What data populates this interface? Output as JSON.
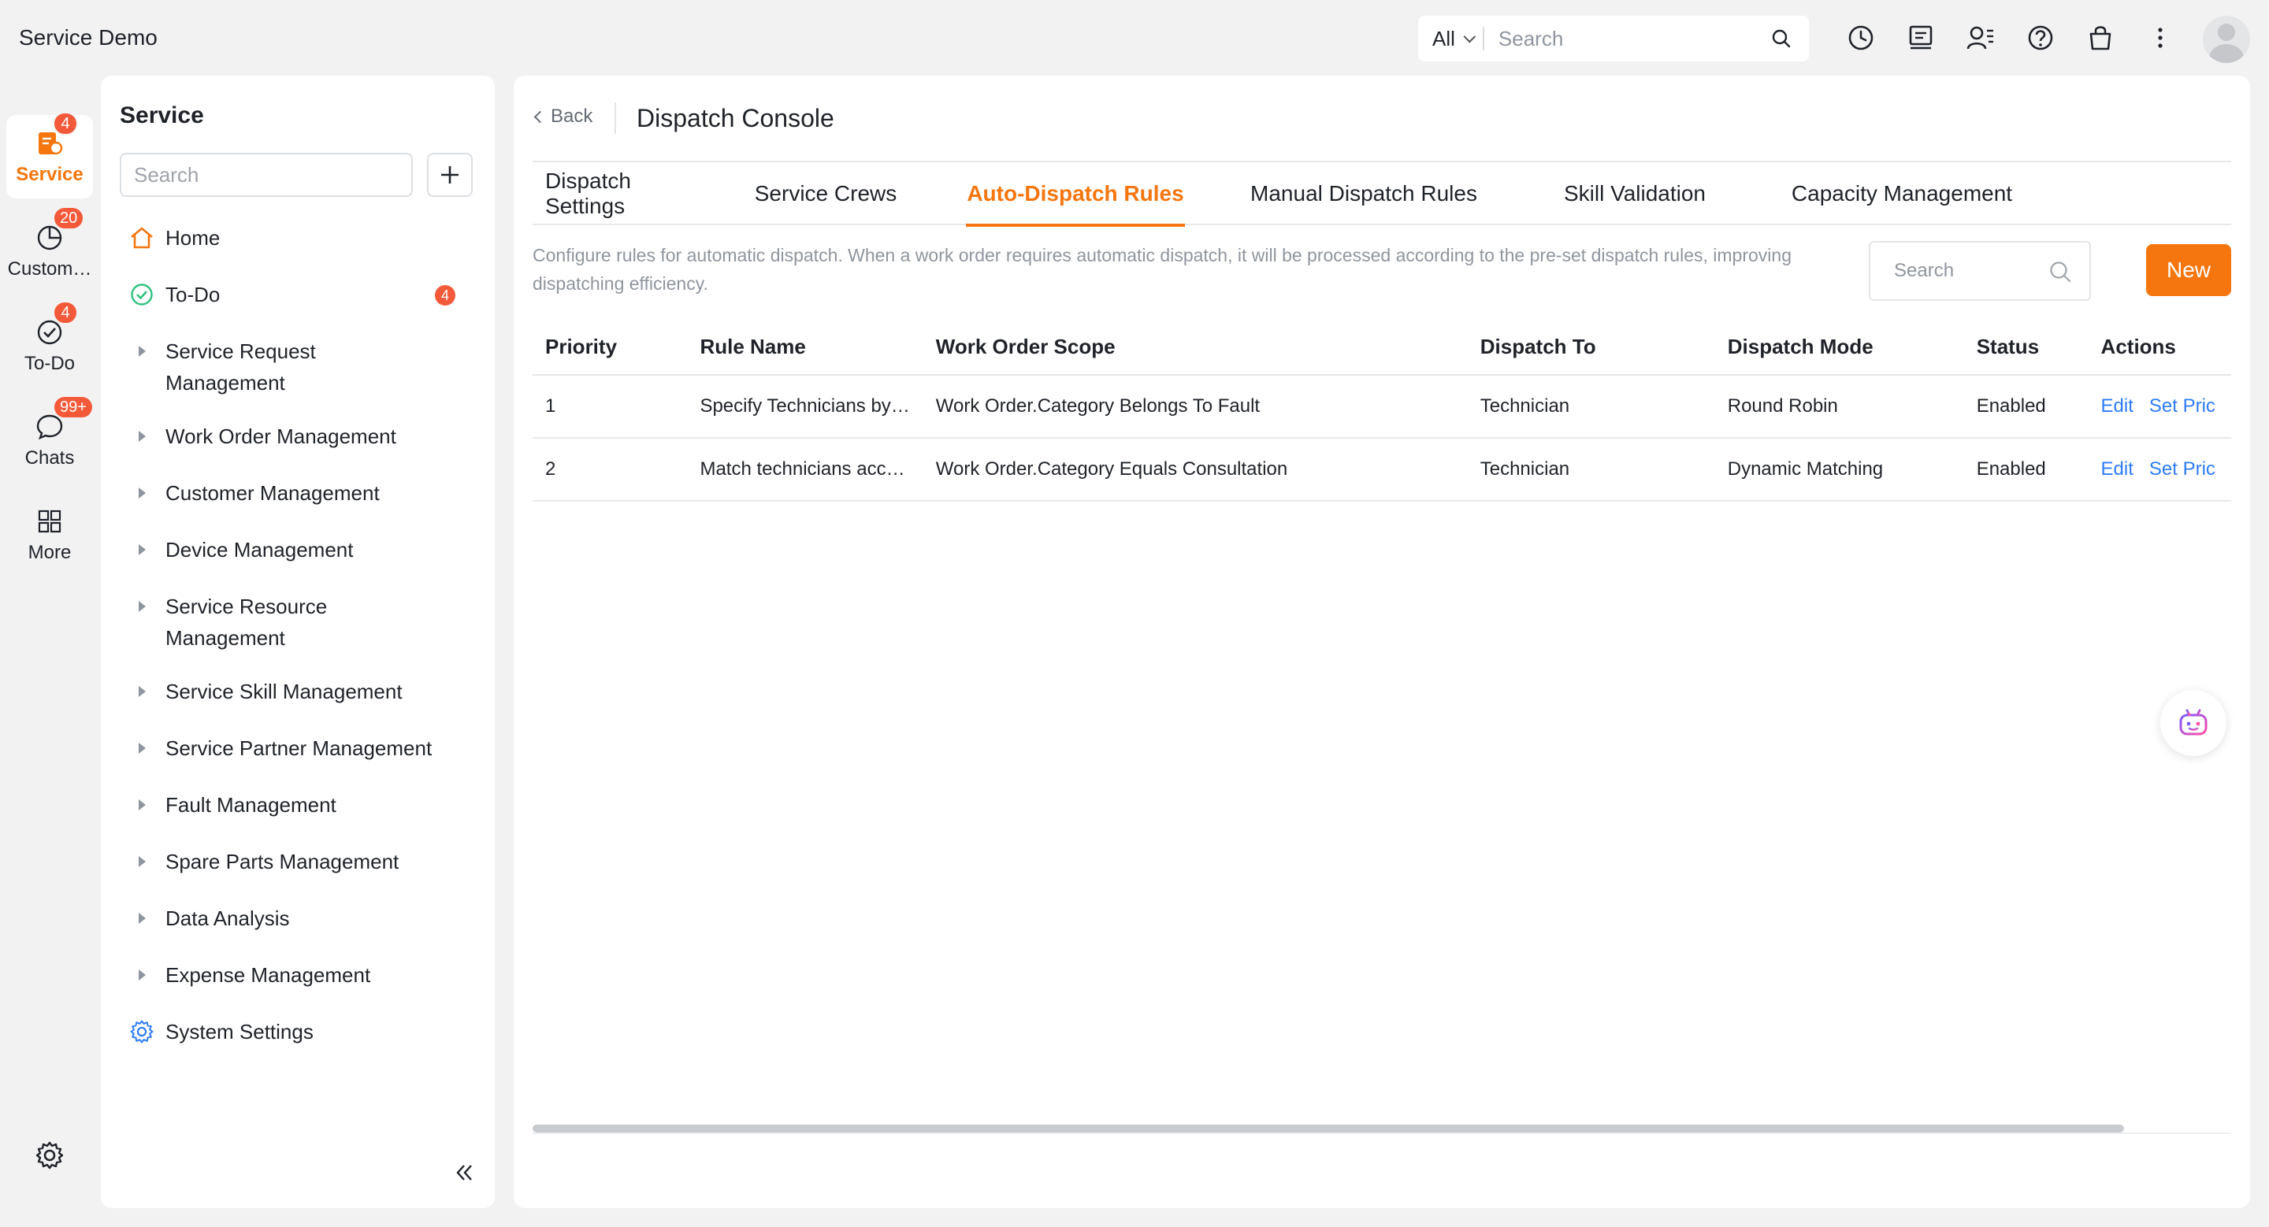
{
  "app": {
    "title": "Service Demo"
  },
  "global_search": {
    "scope": "All",
    "placeholder": "Search"
  },
  "top_icons": [
    "history-icon",
    "notes-icon",
    "contacts-icon",
    "help-icon",
    "bag-icon",
    "more-vertical-icon"
  ],
  "rail": [
    {
      "label": "Service",
      "badge": "4",
      "icon": "service-icon",
      "active": true
    },
    {
      "label": "Custom…",
      "badge": "20",
      "icon": "pie-chart-icon",
      "active": false
    },
    {
      "label": "To-Do",
      "badge": "4",
      "icon": "check-circle-icon",
      "active": false
    },
    {
      "label": "Chats",
      "badge": "99+",
      "icon": "chat-icon",
      "active": false
    },
    {
      "label": "More",
      "badge": "",
      "icon": "grid-icon",
      "active": false
    }
  ],
  "sidenav": {
    "title": "Service",
    "search_placeholder": "Search",
    "items": [
      {
        "label": "Home",
        "icon": "home-icon"
      },
      {
        "label": "To-Do",
        "icon": "todo-check-icon",
        "badge": "4"
      },
      {
        "label": "Service Request Management",
        "line1": "Service Request",
        "line2": "Management",
        "icon": "caret-right-icon"
      },
      {
        "label": "Work Order Management",
        "icon": "caret-right-icon"
      },
      {
        "label": "Customer Management",
        "icon": "caret-right-icon"
      },
      {
        "label": "Device Management",
        "icon": "caret-right-icon"
      },
      {
        "label": "Service Resource Management",
        "line1": "Service Resource",
        "line2": "Management",
        "icon": "caret-right-icon"
      },
      {
        "label": "Service Skill Management",
        "icon": "caret-right-icon"
      },
      {
        "label": "Service Partner Management",
        "icon": "caret-right-icon"
      },
      {
        "label": "Fault Management",
        "icon": "caret-right-icon"
      },
      {
        "label": "Spare Parts Management",
        "icon": "caret-right-icon"
      },
      {
        "label": "Data Analysis",
        "icon": "caret-right-icon"
      },
      {
        "label": "Expense Management",
        "icon": "caret-right-icon"
      },
      {
        "label": "System Settings",
        "icon": "gear-icon"
      }
    ]
  },
  "header": {
    "back_label": "Back",
    "title": "Dispatch Console"
  },
  "tabs": [
    {
      "label": "Dispatch Settings",
      "active": false
    },
    {
      "label": "Service Crews",
      "active": false
    },
    {
      "label": "Auto-Dispatch Rules",
      "active": true
    },
    {
      "label": "Manual Dispatch Rules",
      "active": false
    },
    {
      "label": "Skill Validation",
      "active": false
    },
    {
      "label": "Capacity Management",
      "active": false
    }
  ],
  "description": "Configure rules for automatic dispatch. When a work order requires automatic dispatch, it will be processed according to the pre-set dispatch rules, improving dispatching efficiency.",
  "table_search_placeholder": "Search",
  "new_button": "New",
  "table": {
    "columns": [
      "Priority",
      "Rule Name",
      "Work Order Scope",
      "Dispatch To",
      "Dispatch Mode",
      "Status",
      "Actions"
    ],
    "rows": [
      {
        "priority": "1",
        "rule_name": "Specify Technicians by…",
        "scope": "Work Order.Category Belongs To Fault",
        "dispatch_to": "Technician",
        "mode": "Round Robin",
        "status": "Enabled",
        "actions": [
          "Edit",
          "Set Pric"
        ]
      },
      {
        "priority": "2",
        "rule_name": "Match technicians acc…",
        "scope": "Work Order.Category Equals Consultation",
        "dispatch_to": "Technician",
        "mode": "Dynamic Matching",
        "status": "Enabled",
        "actions": [
          "Edit",
          "Set Pric"
        ]
      }
    ]
  },
  "colors": {
    "accent": "#f5760f",
    "link": "#2e7cf6",
    "badge": "#f45a3a"
  }
}
